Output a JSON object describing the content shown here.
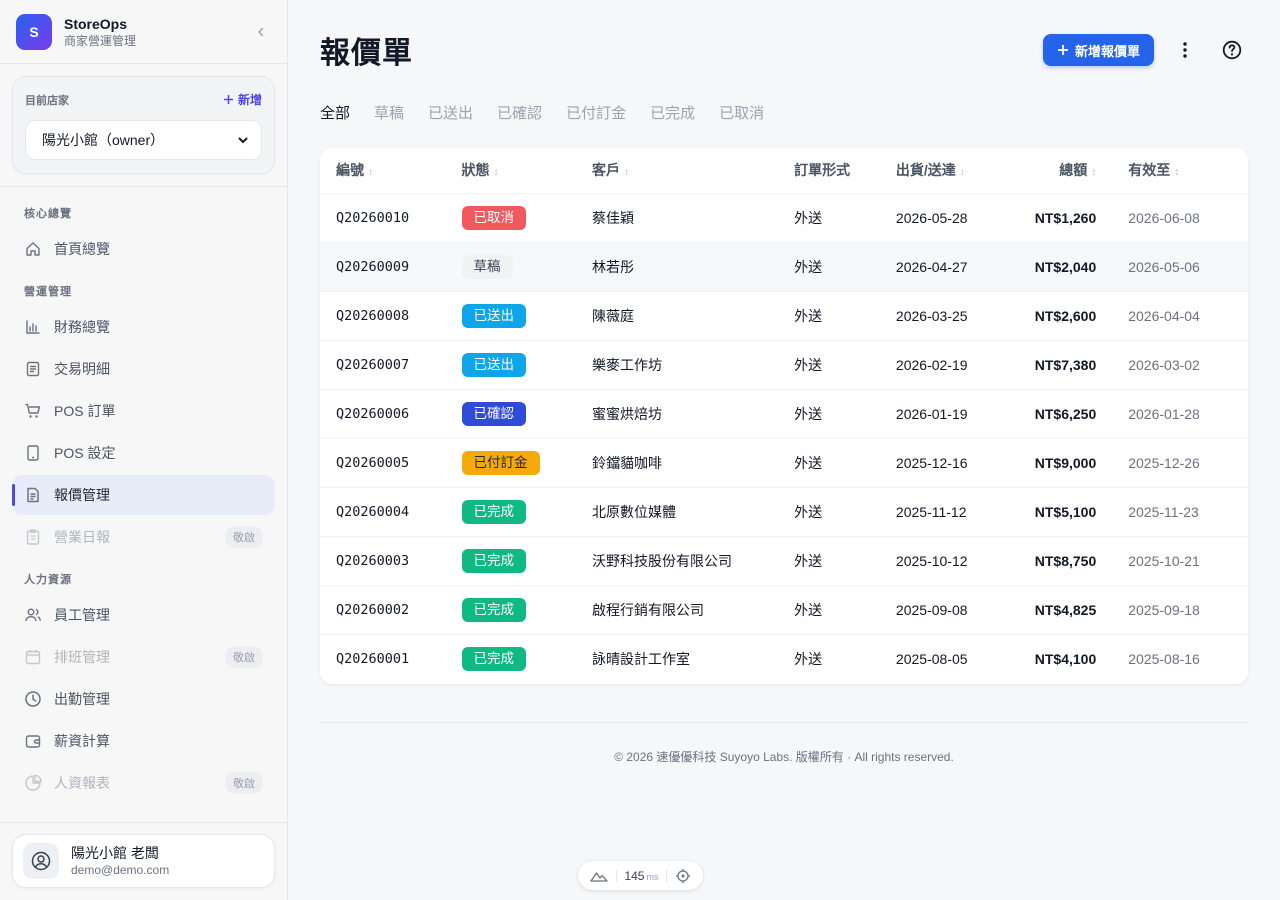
{
  "brand": {
    "initial": "S",
    "name": "StoreOps",
    "subtitle": "商家營運管理"
  },
  "store": {
    "label": "目前店家",
    "new_label": "新增",
    "selected": "陽光小館（owner）"
  },
  "nav": {
    "sections": [
      {
        "title": "核心總覽",
        "items": [
          {
            "label": "首頁總覽",
            "icon": "home-icon"
          }
        ]
      },
      {
        "title": "營運管理",
        "items": [
          {
            "label": "財務總覽",
            "icon": "bar-chart-icon"
          },
          {
            "label": "交易明細",
            "icon": "document-icon"
          },
          {
            "label": "POS 訂單",
            "icon": "cart-icon"
          },
          {
            "label": "POS 設定",
            "icon": "tablet-icon"
          },
          {
            "label": "報價管理",
            "icon": "quote-icon",
            "active": true
          },
          {
            "label": "營業日報",
            "icon": "clipboard-icon",
            "disabled": true,
            "badge": "敬啟"
          }
        ]
      },
      {
        "title": "人力資源",
        "items": [
          {
            "label": "員工管理",
            "icon": "users-icon"
          },
          {
            "label": "排班管理",
            "icon": "calendar-icon",
            "disabled": true,
            "badge": "敬啟"
          },
          {
            "label": "出勤管理",
            "icon": "clock-icon"
          },
          {
            "label": "薪資計算",
            "icon": "wallet-icon"
          },
          {
            "label": "人資報表",
            "icon": "pie-icon",
            "disabled": true,
            "badge": "敬啟"
          }
        ]
      }
    ]
  },
  "user": {
    "name": "陽光小館 老闆",
    "email": "demo@demo.com"
  },
  "page": {
    "title": "報價單",
    "new_button": "新增報價單"
  },
  "tabs": [
    "全部",
    "草稿",
    "已送出",
    "已確認",
    "已付訂金",
    "已完成",
    "已取消"
  ],
  "active_tab": "全部",
  "table": {
    "headers": {
      "id": "編號",
      "status": "狀態",
      "customer": "客戶",
      "type": "訂單形式",
      "date": "出貨/送達",
      "total": "總額",
      "expiry": "有效至"
    },
    "rows": [
      {
        "id": "Q20260010",
        "status": "已取消",
        "customer": "蔡佳穎",
        "type": "外送",
        "date": "2026-05-28",
        "total": "NT$1,260",
        "expiry": "2026-06-08"
      },
      {
        "id": "Q20260009",
        "status": "草稿",
        "customer": "林若彤",
        "type": "外送",
        "date": "2026-04-27",
        "total": "NT$2,040",
        "expiry": "2026-05-06"
      },
      {
        "id": "Q20260008",
        "status": "已送出",
        "customer": "陳薇庭",
        "type": "外送",
        "date": "2026-03-25",
        "total": "NT$2,600",
        "expiry": "2026-04-04"
      },
      {
        "id": "Q20260007",
        "status": "已送出",
        "customer": "樂麥工作坊",
        "type": "外送",
        "date": "2026-02-19",
        "total": "NT$7,380",
        "expiry": "2026-03-02"
      },
      {
        "id": "Q20260006",
        "status": "已確認",
        "customer": "蜜蜜烘焙坊",
        "type": "外送",
        "date": "2026-01-19",
        "total": "NT$6,250",
        "expiry": "2026-01-28"
      },
      {
        "id": "Q20260005",
        "status": "已付訂金",
        "customer": "鈴鐺貓咖啡",
        "type": "外送",
        "date": "2025-12-16",
        "total": "NT$9,000",
        "expiry": "2025-12-26"
      },
      {
        "id": "Q20260004",
        "status": "已完成",
        "customer": "北原數位媒體",
        "type": "外送",
        "date": "2025-11-12",
        "total": "NT$5,100",
        "expiry": "2025-11-23"
      },
      {
        "id": "Q20260003",
        "status": "已完成",
        "customer": "沃野科技股份有限公司",
        "type": "外送",
        "date": "2025-10-12",
        "total": "NT$8,750",
        "expiry": "2025-10-21"
      },
      {
        "id": "Q20260002",
        "status": "已完成",
        "customer": "啟程行銷有限公司",
        "type": "外送",
        "date": "2025-09-08",
        "total": "NT$4,825",
        "expiry": "2025-09-18"
      },
      {
        "id": "Q20260001",
        "status": "已完成",
        "customer": "詠晴設計工作室",
        "type": "外送",
        "date": "2025-08-05",
        "total": "NT$4,100",
        "expiry": "2025-08-16"
      }
    ]
  },
  "status_colors": {
    "已取消": {
      "bg": "#f05a5f",
      "fg": "#ffffff"
    },
    "草稿": {
      "bg": "#f1f2f4",
      "fg": "#374151"
    },
    "已送出": {
      "bg": "#0ea5e9",
      "fg": "#ffffff"
    },
    "已確認": {
      "bg": "#2f4bd8",
      "fg": "#ffffff"
    },
    "已付訂金": {
      "bg": "#f5a90b",
      "fg": "#1f2937"
    },
    "已完成": {
      "bg": "#10b981",
      "fg": "#ffffff"
    }
  },
  "footer": "© 2026 速優優科技 Suyoyo Labs. 版權所有 · All rights reserved.",
  "perf": {
    "value": "145",
    "unit": "ms"
  }
}
